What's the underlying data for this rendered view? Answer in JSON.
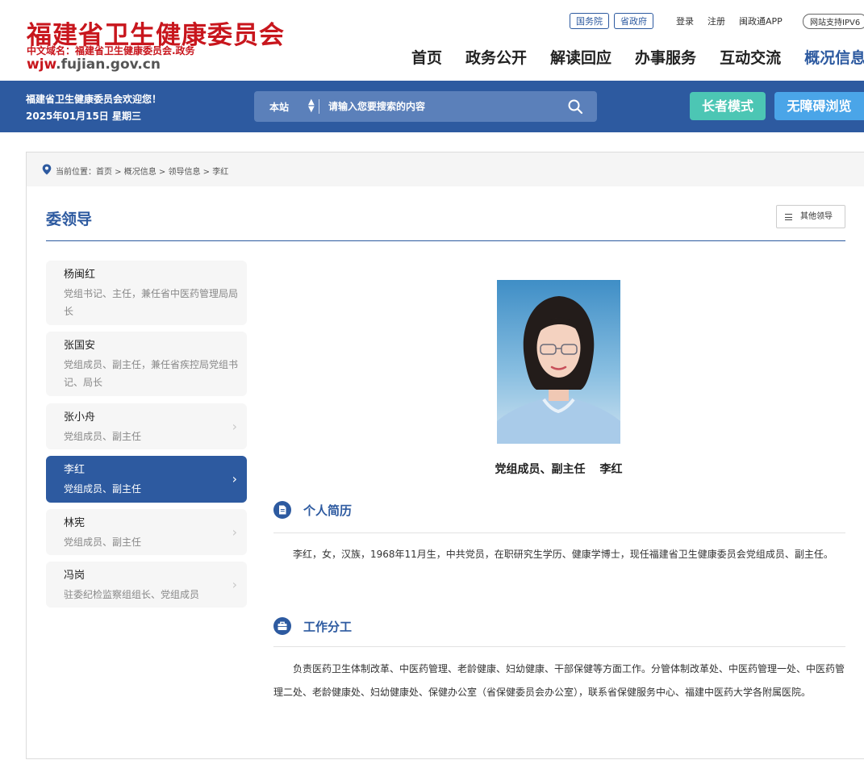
{
  "header": {
    "site_title": "福建省卫生健康委员会",
    "domain_cn": "中文域名：福建省卫生健康委员会.政务",
    "domain_url_w": "wjw",
    "domain_url_rest": ".fujian.gov.cn",
    "pill_links": [
      "国务院",
      "省政府"
    ],
    "top_links": [
      "登录",
      "注册",
      "闽政通APP"
    ],
    "ipv6": "网站支持IPV6",
    "nav": [
      "首页",
      "政务公开",
      "解读回应",
      "办事服务",
      "互动交流",
      "概况信息"
    ],
    "nav_active_index": 5
  },
  "bar": {
    "welcome": "福建省卫生健康委员会欢迎您！",
    "date": "2025年01月15日 星期三",
    "search_scope": "本站",
    "search_placeholder": "请输入您要搜索的内容",
    "elder_mode": "长者模式",
    "accessible": "无障碍浏览"
  },
  "breadcrumb": "当前位置：首页 > 概况信息 > 领导信息 > 李红",
  "section": {
    "title": "委领导",
    "other_leaders_button": "其他领导"
  },
  "leaders": [
    {
      "name": "杨闽红",
      "role": "党组书记、主任，兼任省中医药管理局局长"
    },
    {
      "name": "张国安",
      "role": "党组成员、副主任，兼任省疾控局党组书记、局长"
    },
    {
      "name": "张小舟",
      "role": "党组成员、副主任"
    },
    {
      "name": "李红",
      "role": "党组成员、副主任"
    },
    {
      "name": "林宪",
      "role": "党组成员、副主任"
    },
    {
      "name": "冯岗",
      "role": "驻委纪检监察组组长、党组成员"
    }
  ],
  "active_leader_index": 3,
  "profile": {
    "caption_title": "党组成员、副主任",
    "caption_name": "李红",
    "bio_heading": "个人简历",
    "bio": "李红，女，汉族，1968年11月生，中共党员，在职研究生学历、健康学博士，现任福建省卫生健康委员会党组成员、副主任。",
    "duty_heading": "工作分工",
    "duty": "负责医药卫生体制改革、中医药管理、老龄健康、妇幼健康、干部保健等方面工作。分管体制改革处、中医药管理一处、中医药管理二处、老龄健康处、妇幼健康处、保健办公室（省保健委员会办公室），联系省保健服务中心、福建中医药大学各附属医院。"
  },
  "colors": {
    "brand_red": "#c8161d",
    "brand_blue": "#2d5aa0",
    "elder_green": "#4cc6b4",
    "access_blue": "#4aa5e8"
  }
}
